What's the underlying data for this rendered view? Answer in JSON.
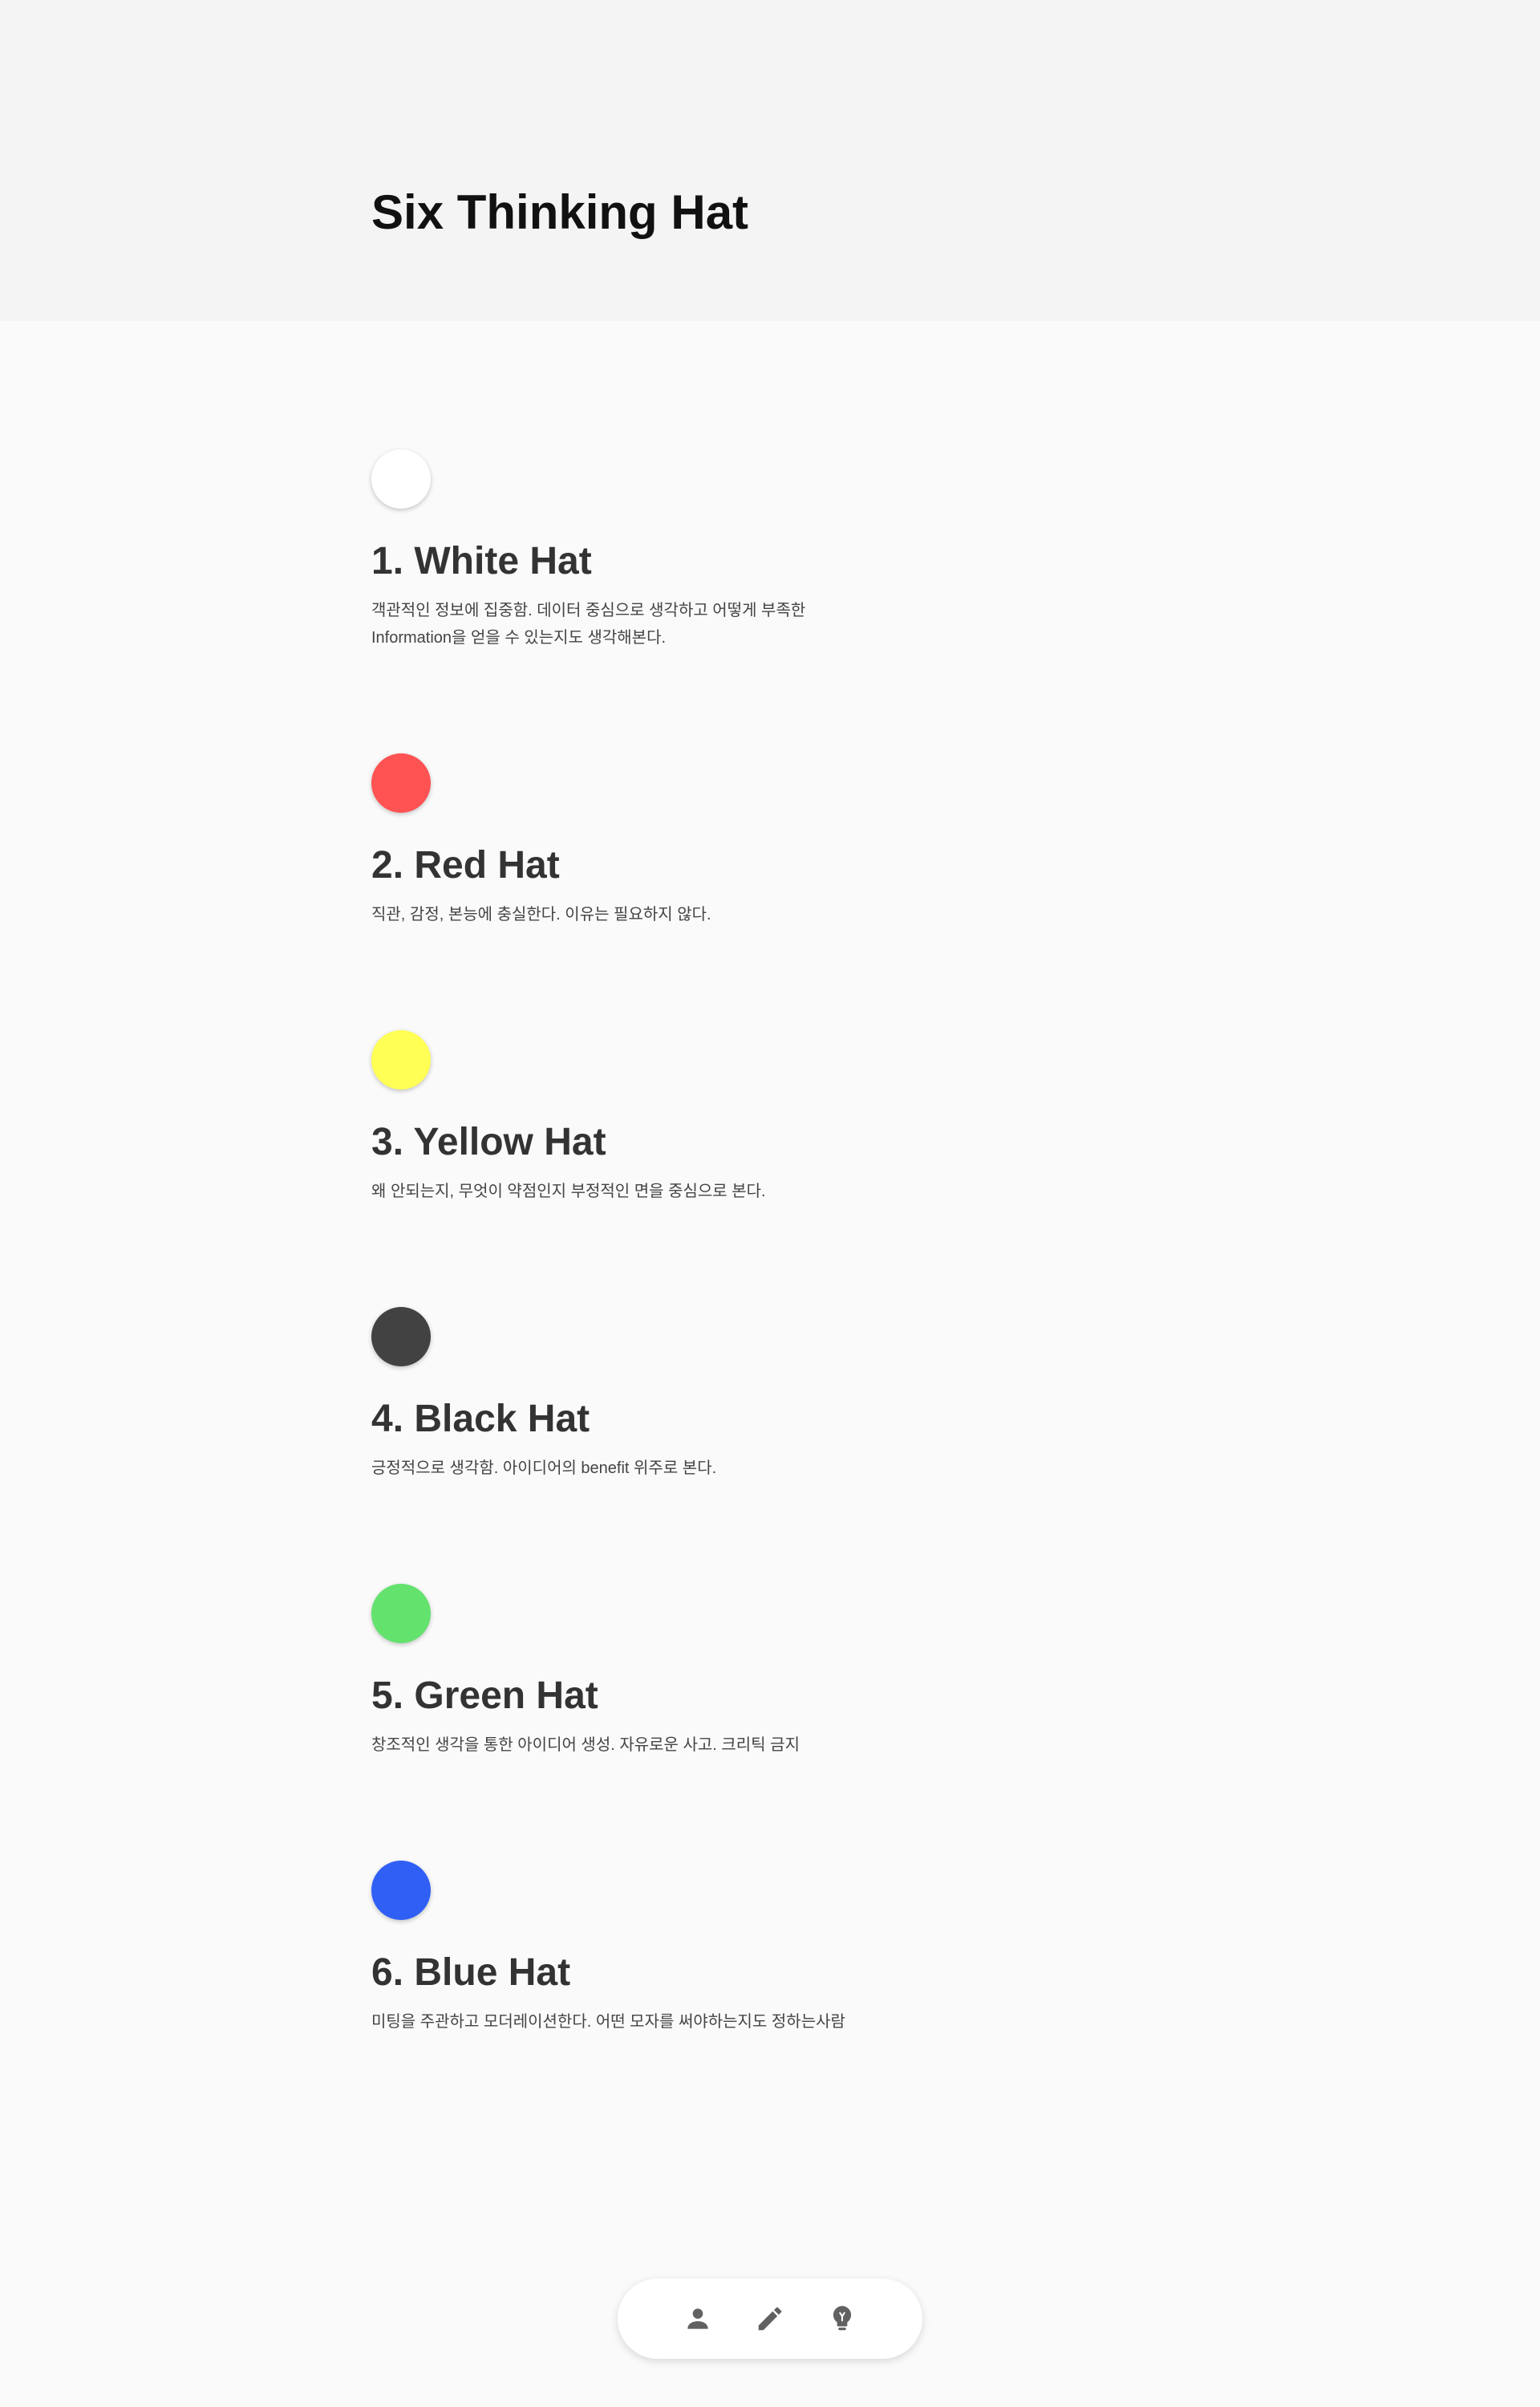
{
  "header": {
    "title": "Six Thinking Hat"
  },
  "hats": [
    {
      "title": "1. White Hat",
      "color": "#ffffff",
      "description": "객관적인 정보에 집중함. 데이터 중심으로 생각하고 어떻게 부족한\nInformation을 얻을 수 있는지도 생각해본다."
    },
    {
      "title": "2. Red Hat",
      "color": "#ff5252",
      "description": "직관, 감정, 본능에 충실한다. 이유는 필요하지 않다."
    },
    {
      "title": "3. Yellow Hat",
      "color": "#ffff55",
      "description": "왜 안되는지, 무엇이 약점인지 부정적인 면을 중심으로 본다."
    },
    {
      "title": "4. Black Hat",
      "color": "#424242",
      "description": "긍정적으로 생각함. 아이디어의 benefit 위주로 본다."
    },
    {
      "title": "5. Green Hat",
      "color": "#63e26e",
      "description": " 창조적인 생각을 통한 아이디어 생성. 자유로운 사고. 크리틱 금지"
    },
    {
      "title": "6. Blue Hat",
      "color": "#2f5ff5",
      "description": "미팅을 주관하고 모더레이션한다. 어떤 모자를 써야하는지도 정하는사람"
    }
  ],
  "bottom_nav": {
    "items": [
      {
        "icon": "person-icon"
      },
      {
        "icon": "pencil-icon"
      },
      {
        "icon": "lightbulb-icon"
      }
    ],
    "icon_color": "#616161"
  }
}
